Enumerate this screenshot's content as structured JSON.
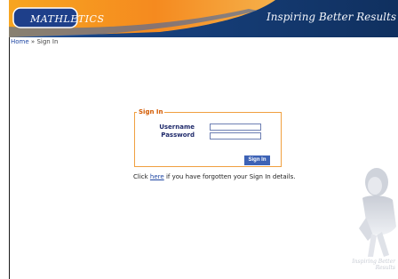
{
  "header": {
    "logo_text": "MATHLETICS",
    "tagline": "Inspiring Better Results"
  },
  "breadcrumb": {
    "home": "Home",
    "separator": "»",
    "current": "Sign In"
  },
  "signin": {
    "legend": "Sign In",
    "username_label": "Username",
    "password_label": "Password",
    "username_value": "",
    "password_value": "",
    "button_label": "Sign In"
  },
  "help": {
    "prefix": "Click",
    "link": "here",
    "suffix": "if you have forgotten your Sign In details."
  },
  "watermark": {
    "line1": "Inspiring Better",
    "line2": "Results"
  },
  "colors": {
    "header_blue": "#17396e",
    "accent_orange": "#f39a2a",
    "link_blue": "#1f47a3",
    "button_blue": "#3d62b5"
  }
}
